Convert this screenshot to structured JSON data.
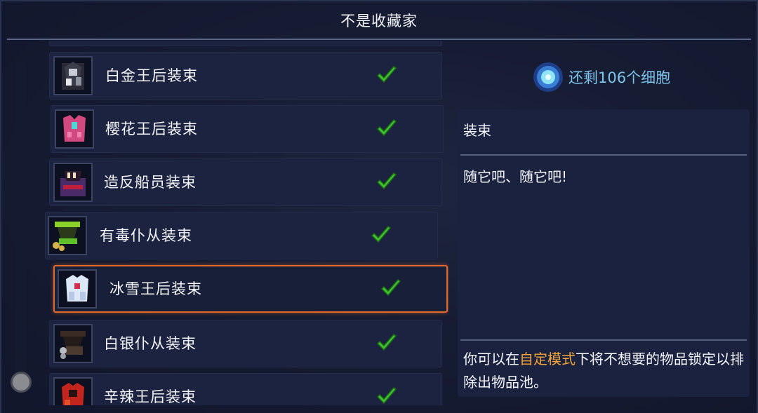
{
  "title": "不是收藏家",
  "cells": {
    "text": "还剩106个细胞"
  },
  "detail": {
    "category": "装束",
    "description": "随它吧、随它吧!",
    "footer_before": "你可以在",
    "footer_highlight": "自定模式",
    "footer_after": "下将不想要的物品锁定以排除出物品池。",
    "highlight_color": "#f4a53a"
  },
  "items": [
    {
      "label": "白金王后装束",
      "checked": true,
      "icon": "platinum-queen-outfit-icon"
    },
    {
      "label": "樱花王后装束",
      "checked": true,
      "icon": "sakura-queen-outfit-icon"
    },
    {
      "label": "造反船员装束",
      "checked": true,
      "icon": "mutinous-crew-outfit-icon"
    },
    {
      "label": "有毒仆从装束",
      "checked": true,
      "icon": "toxic-servant-outfit-icon"
    },
    {
      "label": "冰雪王后装束",
      "checked": true,
      "icon": "ice-queen-outfit-icon",
      "selected": true
    },
    {
      "label": "白银仆从装束",
      "checked": true,
      "icon": "silver-servant-outfit-icon"
    },
    {
      "label": "辛辣王后装束",
      "checked": true,
      "icon": "spicy-queen-outfit-icon"
    }
  ],
  "colors": {
    "check": "#3ec42f",
    "selection": "#e0682a",
    "cells_text": "#7ec3ea"
  }
}
